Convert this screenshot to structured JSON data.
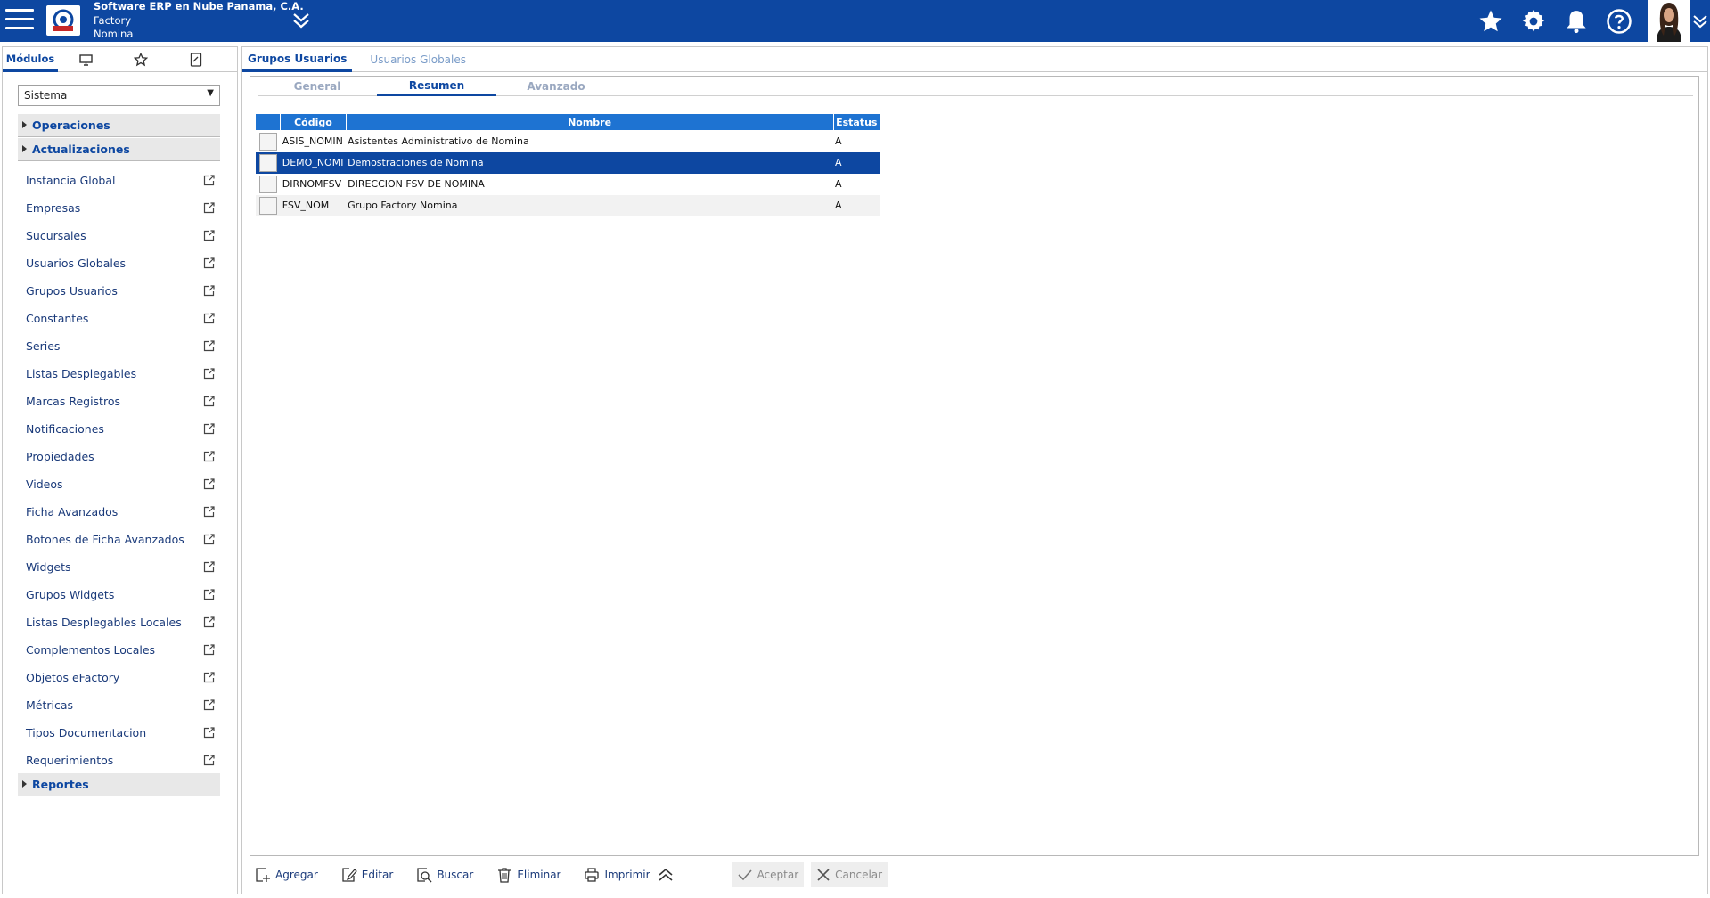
{
  "header": {
    "company_name": "Software ERP en Nube Panama, C.A.",
    "group": "Factory",
    "module": "Nomina",
    "colors": {
      "bar": "#0d47a1",
      "accent": "#1e73d2"
    },
    "icons": [
      "menu-icon",
      "company-logo",
      "chevron-double-down-icon",
      "star-icon",
      "gear-icon",
      "bell-icon",
      "help-icon",
      "user-avatar",
      "chevron-double-down-icon"
    ]
  },
  "sidebar": {
    "tabs": [
      "Módulos",
      "monitor-icon",
      "star-icon",
      "document-icon"
    ],
    "module_select": "Sistema",
    "groups": {
      "operaciones": "Operaciones",
      "actualizaciones": "Actualizaciones",
      "reportes": "Reportes"
    },
    "items": [
      "Instancia Global",
      "Empresas",
      "Sucursales",
      "Usuarios Globales",
      "Grupos Usuarios",
      "Constantes",
      "Series",
      "Listas Desplegables",
      "Marcas Registros",
      "Notificaciones",
      "Propiedades",
      "Videos",
      "Ficha Avanzados",
      "Botones de Ficha Avanzados",
      "Widgets",
      "Grupos Widgets",
      "Listas Desplegables Locales",
      "Complementos Locales",
      "Objetos eFactory",
      "Métricas",
      "Tipos Documentacion",
      "Requerimientos"
    ]
  },
  "main": {
    "tabs": [
      "Grupos Usuarios",
      "Usuarios Globales"
    ],
    "subtabs": [
      "General",
      "Resumen",
      "Avanzado"
    ],
    "table": {
      "columns": [
        "Código",
        "Nombre",
        "Estatus"
      ],
      "rows": [
        {
          "code": "ASIS_NOMIN",
          "name": "Asistentes Administrativo de Nomina",
          "status": "A"
        },
        {
          "code": "DEMO_NOMI",
          "name": "Demostraciones de Nomina",
          "status": "A"
        },
        {
          "code": "DIRNOMFSV",
          "name": "DIRECCION FSV DE NOMINA",
          "status": "A"
        },
        {
          "code": "FSV_NOM",
          "name": "Grupo Factory Nomina",
          "status": "A"
        }
      ],
      "selected_row": 1
    }
  },
  "toolbar": {
    "agregar": "Agregar",
    "editar": "Editar",
    "buscar": "Buscar",
    "eliminar": "Eliminar",
    "imprimir": "Imprimir",
    "aceptar": "Aceptar",
    "cancelar": "Cancelar"
  }
}
